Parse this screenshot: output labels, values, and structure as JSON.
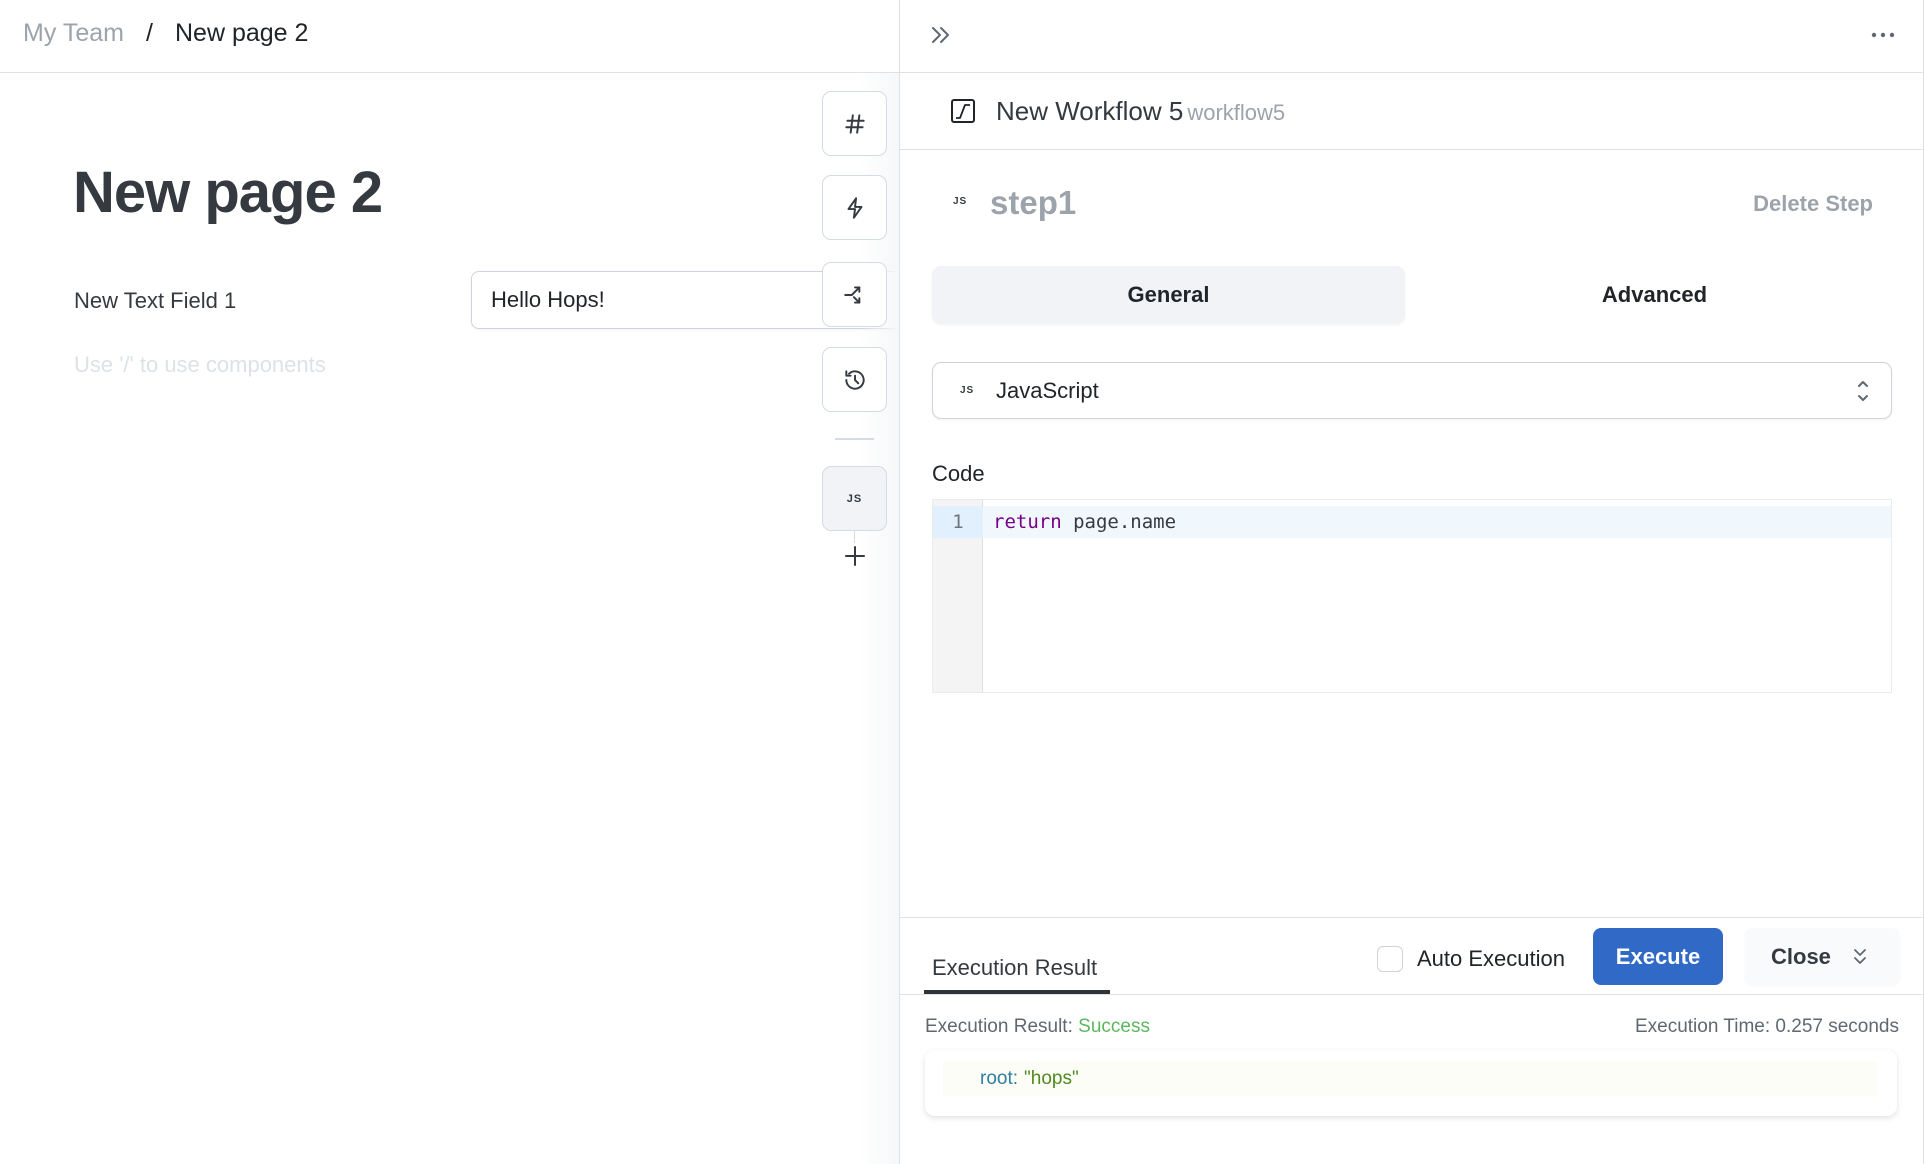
{
  "breadcrumb": {
    "team": "My Team",
    "separator": "/",
    "page": "New page 2"
  },
  "page": {
    "title": "New page 2",
    "text_field": {
      "label": "New Text Field 1",
      "value": "Hello Hops!"
    },
    "hint": "Use '/' to use components"
  },
  "toolbar": {
    "items": [
      {
        "icon": "hash-icon"
      },
      {
        "icon": "lightning-icon"
      },
      {
        "icon": "branch-arrow-icon"
      },
      {
        "icon": "history-icon"
      },
      {
        "icon": "js-icon",
        "label": "JS"
      }
    ],
    "add_icon": "plus-icon"
  },
  "workflow": {
    "title": "New Workflow 5",
    "id": "workflow5",
    "step": {
      "badge": "JS",
      "name": "step1",
      "delete_label": "Delete Step"
    },
    "tabs": [
      {
        "label": "General",
        "active": true
      },
      {
        "label": "Advanced",
        "active": false
      }
    ],
    "language": {
      "badge": "JS",
      "selected": "JavaScript"
    },
    "code": {
      "label": "Code",
      "lines": [
        {
          "number": "1",
          "keyword": "return",
          "rest": " page.name"
        }
      ]
    }
  },
  "execution": {
    "tab_label": "Execution Result",
    "auto_execution_label": "Auto Execution",
    "auto_execution_checked": false,
    "execute_label": "Execute",
    "close_label": "Close",
    "result_prefix": "Execution Result: ",
    "result_status": "Success",
    "time_text": "Execution Time: 0.257 seconds",
    "output": {
      "key": "root:",
      "value": "\"hops\""
    }
  },
  "colors": {
    "primary": "#3069c6",
    "success": "#5cb85c",
    "keyword": "#770088",
    "muted": "#9ca3ab"
  }
}
